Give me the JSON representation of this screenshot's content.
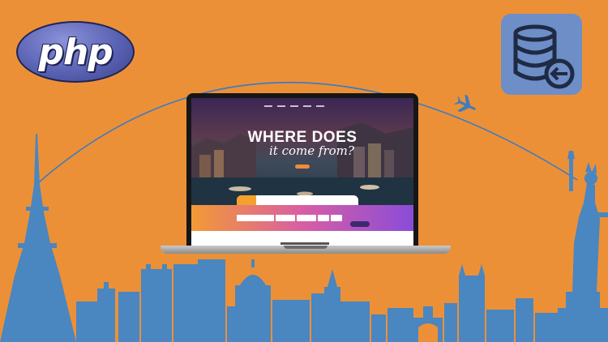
{
  "logo": {
    "text": "php"
  },
  "hero": {
    "headline": "WHERE DOES",
    "tagline": "it come from?"
  },
  "colors": {
    "background": "#ec9038",
    "skyline": "#4a86c0",
    "db_tile": "#6e8ec7",
    "arc": "#3f7bbf"
  },
  "icons": [
    "database-arrow-icon",
    "airplane-icon",
    "eiffel-tower-icon",
    "statue-of-liberty-icon"
  ]
}
